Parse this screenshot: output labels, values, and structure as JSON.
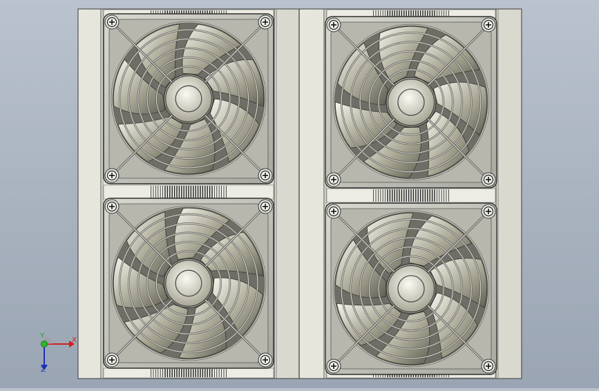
{
  "scene": {
    "background_top": "#b9c2cd",
    "background_bottom": "#9aa5b3",
    "housing_color": "#e9e9e0",
    "housing_edge": "#3c3c3c",
    "fan_frame_color": "#c9c9c1",
    "blade_color": "#b8b6a4",
    "guard_color": "#8c8c86"
  },
  "fans": [
    {
      "id": "fan-top-left"
    },
    {
      "id": "fan-top-right"
    },
    {
      "id": "fan-bottom-left"
    },
    {
      "id": "fan-bottom-right"
    }
  ],
  "triad": {
    "x_label": "X",
    "y_label": "Y",
    "z_label": "Z",
    "x_color": "#d21e1e",
    "y_color": "#22a022",
    "z_color": "#1c2fb8"
  }
}
